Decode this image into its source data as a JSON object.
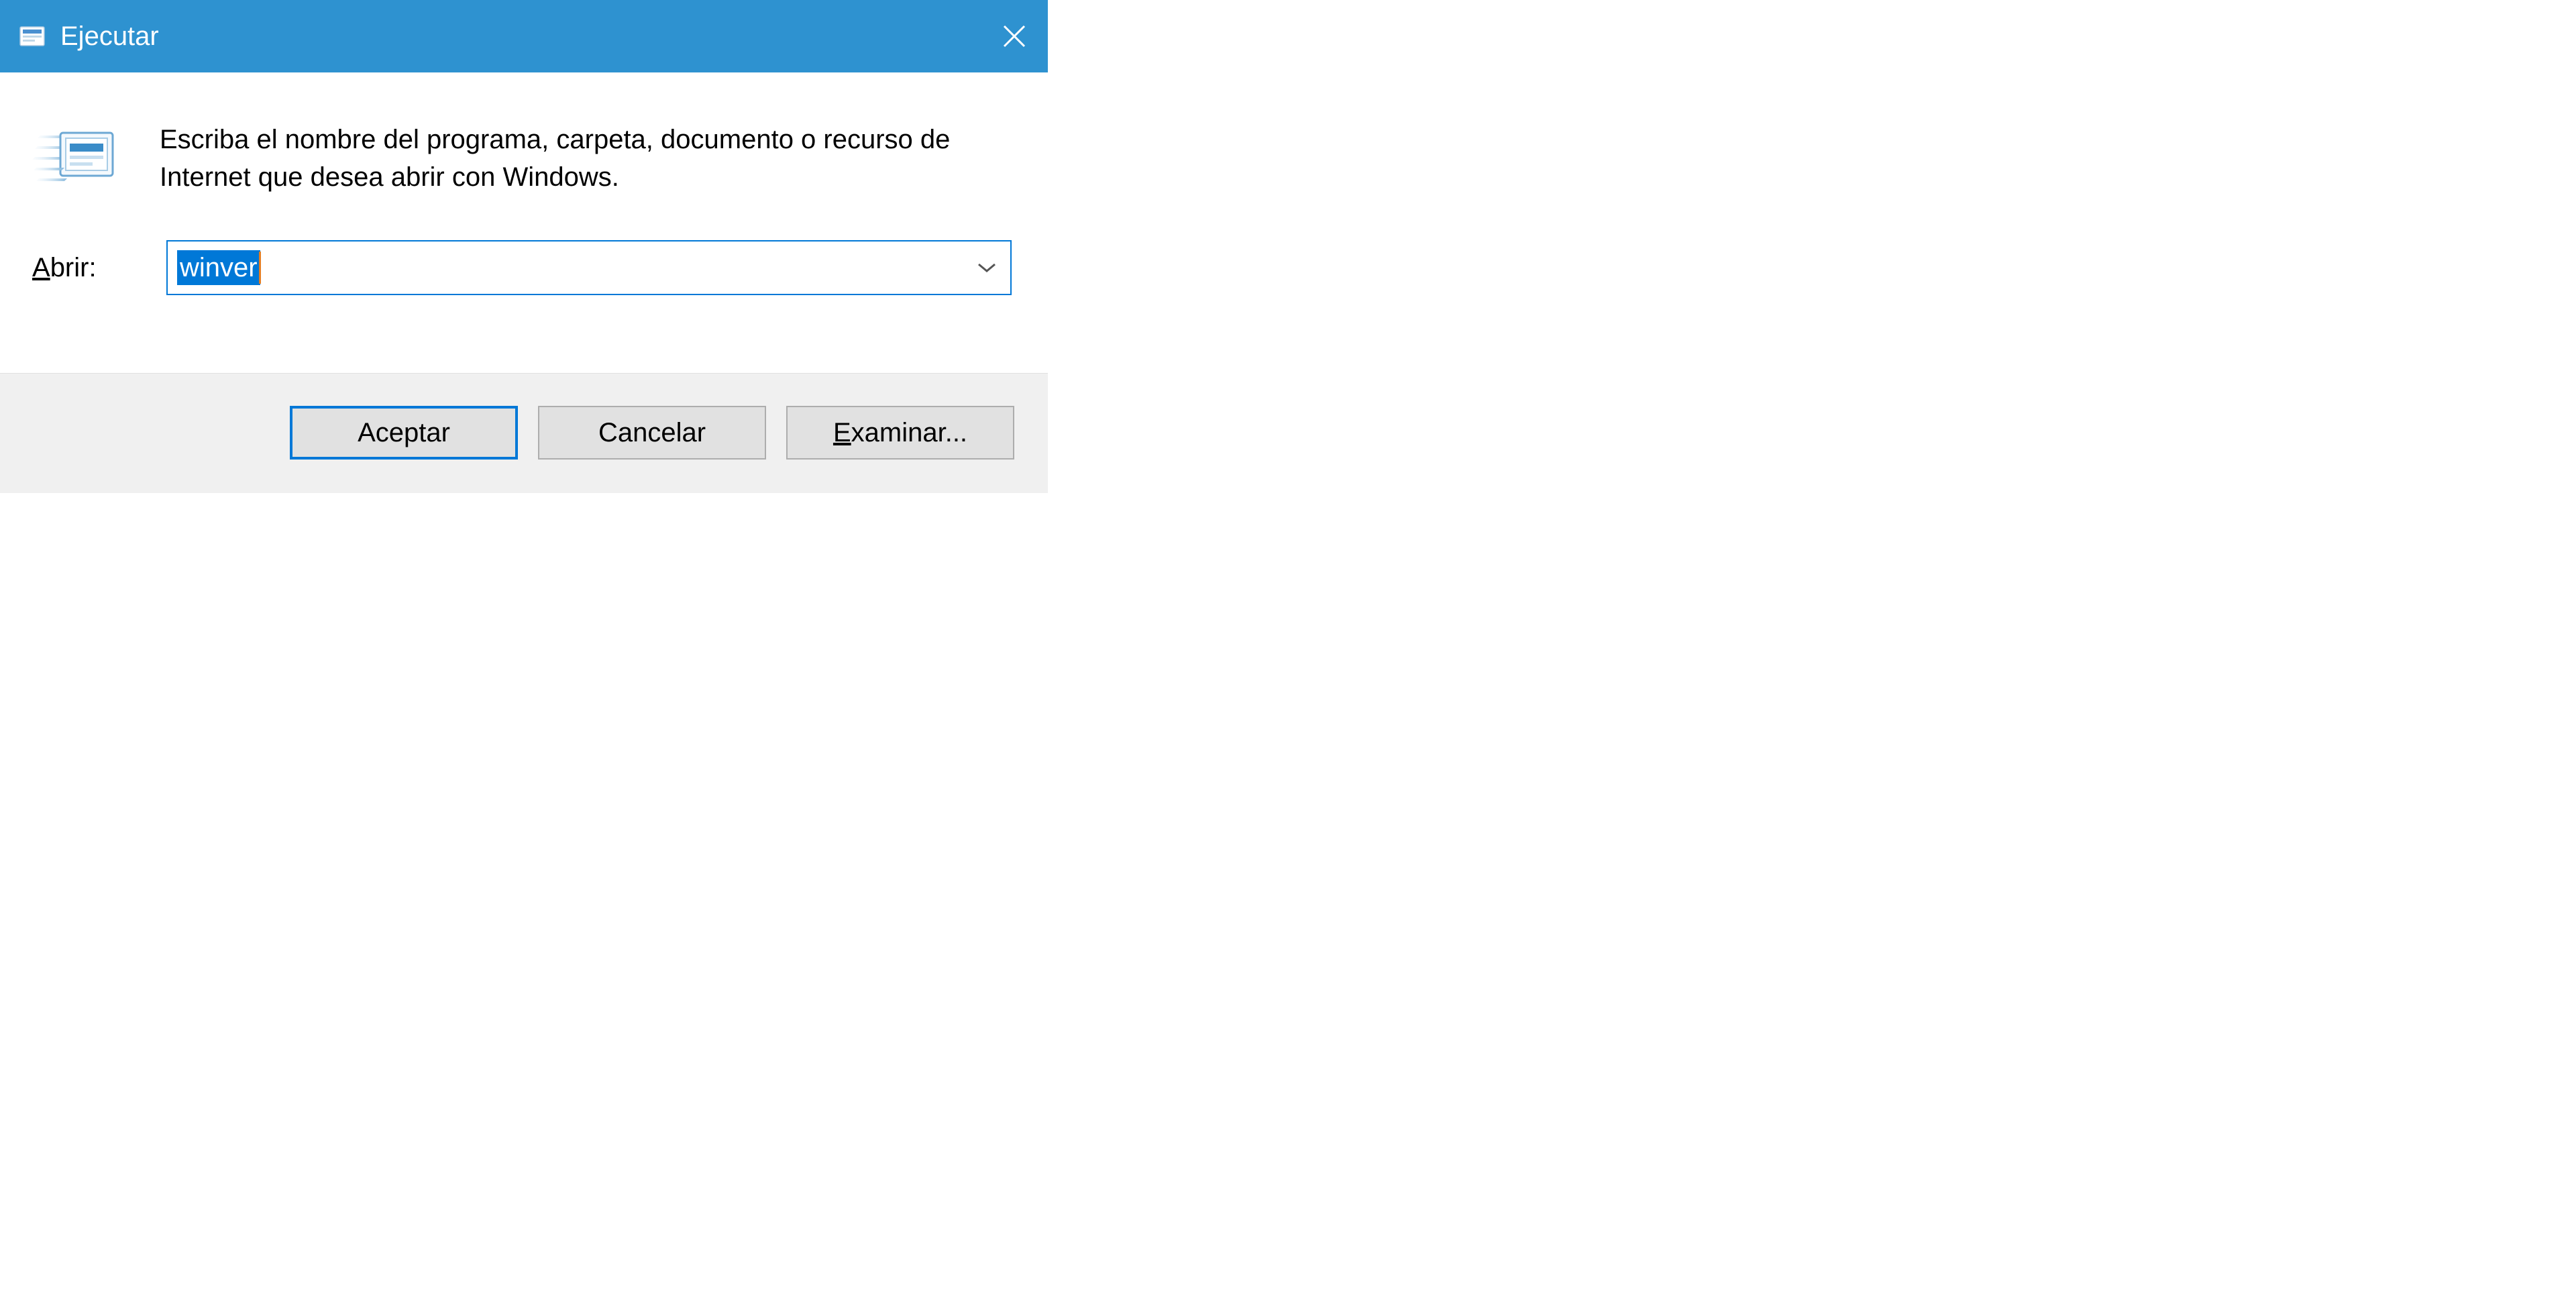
{
  "titlebar": {
    "title": "Ejecutar"
  },
  "content": {
    "description": "Escriba el nombre del programa, carpeta, documento o recurso de Internet que desea abrir con Windows.",
    "input_label_prefix": "A",
    "input_label_suffix": "brir:",
    "input_value": "winver"
  },
  "buttons": {
    "ok": "Aceptar",
    "cancel": "Cancelar",
    "browse_prefix": "E",
    "browse_suffix": "xaminar..."
  }
}
